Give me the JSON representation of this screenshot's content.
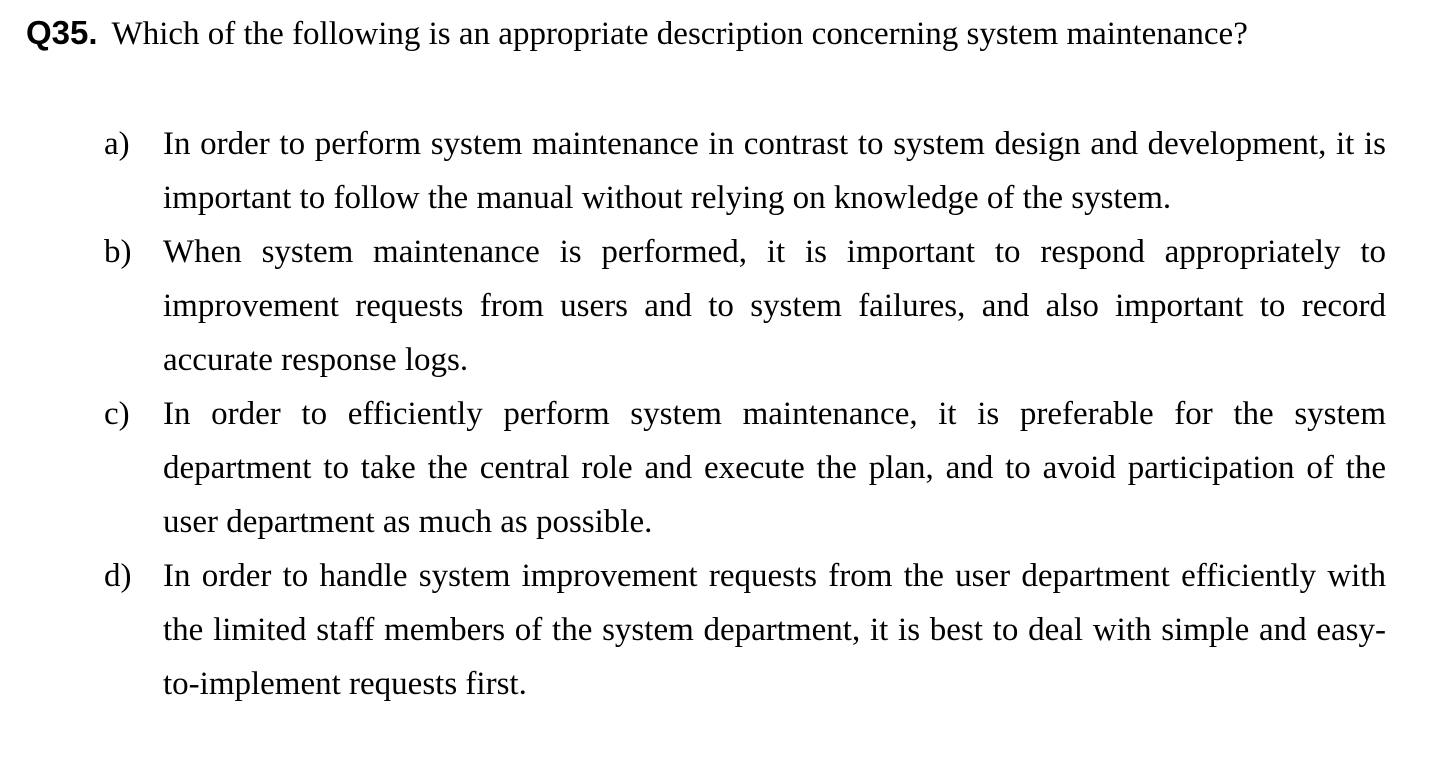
{
  "question": {
    "number": "Q35.",
    "text": "Which of the following is an appropriate description concerning system maintenance?"
  },
  "options": [
    {
      "label": "a)",
      "text": "In order to perform system maintenance in contrast to system design and development, it is important to follow the manual without relying on knowledge of the system."
    },
    {
      "label": "b)",
      "text": "When system maintenance is performed, it is important to respond appropriately to improvement requests from users and to system failures, and also important to record accurate response logs."
    },
    {
      "label": "c)",
      "text": "In order to efficiently perform system maintenance, it is preferable for the system department to take the central role and execute the plan, and to avoid participation of the user department as much as possible."
    },
    {
      "label": "d)",
      "text": "In order to handle system improvement requests from the user department efficiently with the limited staff members of the system department, it is best to deal with simple and easy-to-implement requests first."
    }
  ]
}
